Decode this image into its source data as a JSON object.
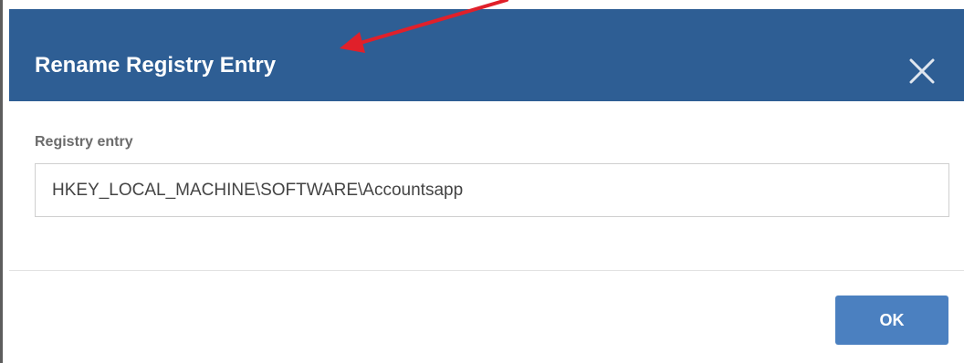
{
  "dialog": {
    "title": "Rename Registry Entry",
    "close_icon": "close-icon",
    "field": {
      "label": "Registry entry",
      "value": "HKEY_LOCAL_MACHINE\\SOFTWARE\\Accountsapp"
    },
    "ok_label": "OK"
  },
  "colors": {
    "header_bg": "#2e5e94",
    "ok_button_bg": "#4b80c0",
    "annotation_arrow": "#e0202a"
  }
}
